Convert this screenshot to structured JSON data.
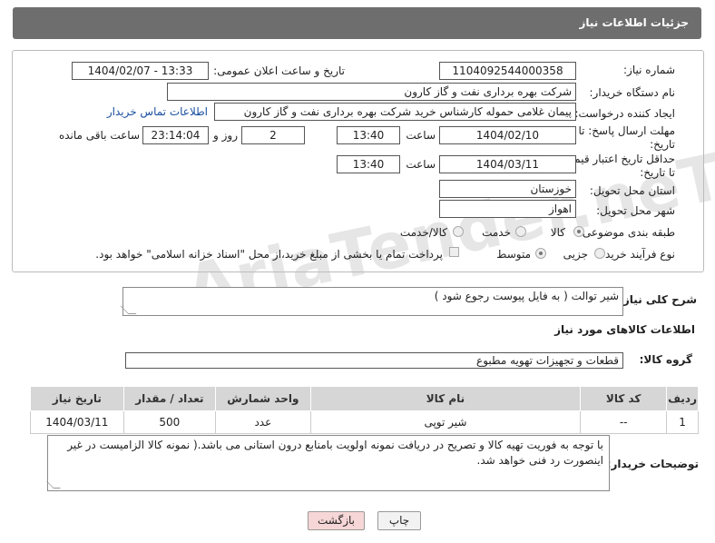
{
  "header": {
    "title": "جزئیات اطلاعات نیاز"
  },
  "fields": {
    "need_number_label": "شماره نیاز:",
    "need_number": "1104092544000358",
    "announce_label": "تاریخ و ساعت اعلان عمومی:",
    "announce_value": "1404/02/07 - 13:33",
    "buyer_org_label": "نام دستگاه خریدار:",
    "buyer_org": "شرکت بهره برداری نفت و گاز کارون",
    "creator_label": "ایجاد کننده درخواست:",
    "creator": "پیمان غلامی حموله کارشناس خرید شرکت بهره برداری نفت و گاز کارون",
    "contact_link": "اطلاعات تماس خریدار",
    "reply_deadline_label_1": "مهلت ارسال پاسخ: تا",
    "reply_deadline_label_2": "تاریخ:",
    "reply_date": "1404/02/10",
    "time_label": "ساعت",
    "reply_time": "13:40",
    "days_value": "2",
    "days_label": "روز و",
    "remaining_value": "23:14:04",
    "remaining_label": "ساعت باقی مانده",
    "validity_label_1": "حداقل تاریخ اعتبار قیمت:",
    "validity_label_2": "تا تاریخ:",
    "validity_date": "1404/03/11",
    "validity_time": "13:40",
    "province_label": "استان محل تحویل:",
    "province": "خوزستان",
    "city_label": "شهر محل تحویل:",
    "city": "اهواز",
    "category_label": "طبقه بندی موضوعی:",
    "category_options": [
      "کالا",
      "خدمت",
      "کالا/خدمت"
    ],
    "purchase_type_label": "نوع فرآیند خرید :",
    "purchase_options": [
      "جزیی",
      "متوسط"
    ],
    "payment_note": "پرداخت تمام یا بخشی از مبلغ خرید،از محل \"اسناد خزانه اسلامی\" خواهد بود."
  },
  "description": {
    "label": "شرح کلی نیاز:",
    "value": "شیر توالت ( به فایل پیوست رجوع شود )"
  },
  "goods": {
    "section_title": "اطلاعات کالاهای مورد نیاز",
    "group_label": "گروه کالا:",
    "group_value": "قطعات و تجهیزات تهویه مطبوع",
    "columns": [
      "ردیف",
      "کد کالا",
      "نام کالا",
      "واحد شمارش",
      "تعداد / مقدار",
      "تاریخ نیاز"
    ],
    "rows": [
      [
        "1",
        "--",
        "شیر توپی",
        "عدد",
        "500",
        "1404/03/11"
      ]
    ]
  },
  "buyer_notes": {
    "label": "توضیحات خریدار:",
    "value": "با توجه به فوریت تهیه کالا و تصریح در دریافت نمونه اولویت بامنابع درون استانی می باشد.( نمونه کالا الزامیست در غیر اینصورت رد فنی خواهد شد."
  },
  "buttons": {
    "print": "چاپ",
    "back": "بازگشت"
  },
  "watermark": "AriaTender.neT",
  "colors": {
    "header_bg": "#6e6e6e",
    "header_text": "#ffffff",
    "link": "#1a4fa0",
    "back_btn": "#f6d6d6"
  }
}
